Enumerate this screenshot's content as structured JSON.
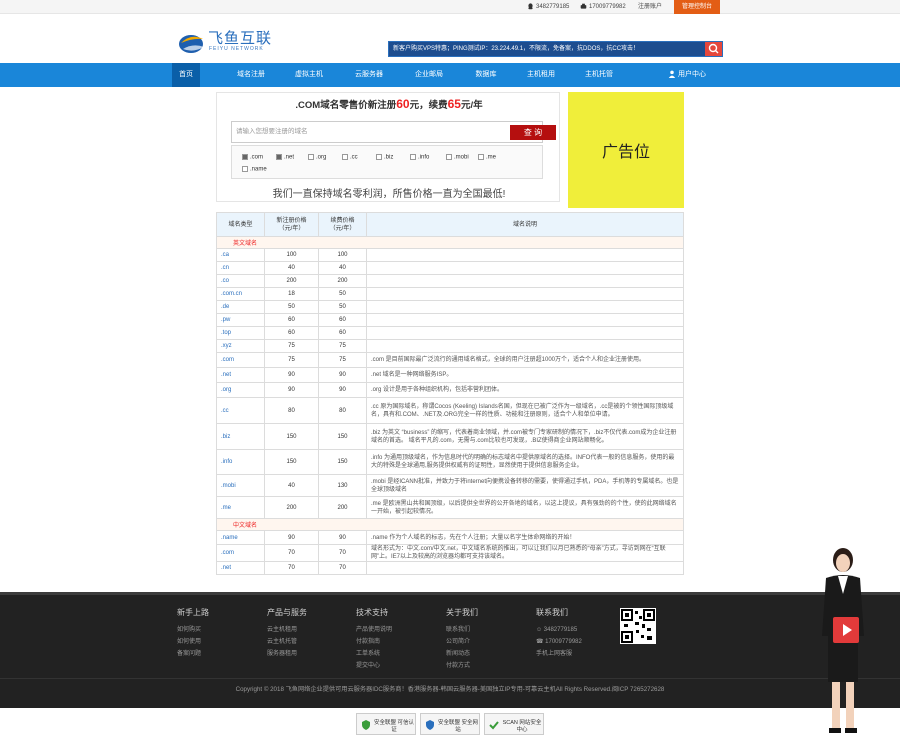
{
  "topbar": {
    "qq": "3482779185",
    "phone": "17009779982",
    "register": "注册账户",
    "console": "管理控制台"
  },
  "header": {
    "logo_text": "飞鱼互联",
    "logo_sub": "FEIYU NETWORK",
    "search_placeholder": "新客户购买VPS特惠；PING测试IP：23.224.49.1，不限流，免备案，抗DDOS，抗CC攻击！"
  },
  "nav": {
    "items": [
      {
        "label": "首页",
        "active": true
      },
      {
        "label": "域名注册",
        "active": false
      },
      {
        "label": "虚拟主机",
        "active": false
      },
      {
        "label": "云服务器",
        "active": false
      },
      {
        "label": "企业邮局",
        "active": false
      },
      {
        "label": "数据库",
        "active": false
      },
      {
        "label": "主机租用",
        "active": false
      },
      {
        "label": "主机托管",
        "active": false
      }
    ],
    "user_center": "用户中心"
  },
  "promo": {
    "title_pre": ".COM域名零售价新注册",
    "reg_price": "60",
    "title_mid": "元，续费",
    "renew_price": "65",
    "title_post": "元/年",
    "input_placeholder": "请输入您想要注册的域名",
    "query_button": "查 询",
    "suffixes": [
      {
        "label": ".com",
        "checked": true
      },
      {
        "label": ".net",
        "checked": true
      },
      {
        "label": ".org",
        "checked": false
      },
      {
        "label": ".cc",
        "checked": false
      },
      {
        "label": ".biz",
        "checked": false
      },
      {
        "label": ".info",
        "checked": false
      },
      {
        "label": ".mobi",
        "checked": false
      },
      {
        "label": ".me",
        "checked": false
      },
      {
        "label": ".name",
        "checked": false
      }
    ],
    "slogan": "我们一直保持域名零利润，所售价格一直为全国最低!"
  },
  "ad": {
    "label": "广告位"
  },
  "table": {
    "headers": [
      "域名类型",
      "新注册价格\n（元/年）",
      "续费价格\n（元/年）",
      "域名说明"
    ],
    "category_en": "英文域名",
    "category_cn": "中文域名",
    "rows": [
      {
        "name": ".ca",
        "reg": "100",
        "renew": "100",
        "desc": ""
      },
      {
        "name": ".cn",
        "reg": "40",
        "renew": "40",
        "desc": ""
      },
      {
        "name": ".co",
        "reg": "200",
        "renew": "200",
        "desc": ""
      },
      {
        "name": ".com.cn",
        "reg": "18",
        "renew": "50",
        "desc": ""
      },
      {
        "name": ".de",
        "reg": "50",
        "renew": "50",
        "desc": ""
      },
      {
        "name": ".pw",
        "reg": "60",
        "renew": "60",
        "desc": ""
      },
      {
        "name": ".top",
        "reg": "60",
        "renew": "60",
        "desc": ""
      },
      {
        "name": ".xyz",
        "reg": "75",
        "renew": "75",
        "desc": ""
      },
      {
        "name": ".com",
        "reg": "75",
        "renew": "75",
        "desc": ".com 是目前国际最广泛流行的通用域名格式，全球的用户注册超1000万个，适合个人和企业注册使用。"
      },
      {
        "name": ".net",
        "reg": "90",
        "renew": "90",
        "desc": ".net 域名是一种网络服务ISP。"
      },
      {
        "name": ".org",
        "reg": "90",
        "renew": "90",
        "desc": ".org 设计是用于各种组织机构，包括非营利团体。"
      },
      {
        "name": ".cc",
        "reg": "80",
        "renew": "80",
        "desc": ".cc 原为国际域名，称谓Cocos (Keeling) Islands名国，但现在已被广泛作为一级域名，.cc是被的个领性国际顶级域名，具有和.COM、.NET及.ORG完全一样的性质、功能和注册原则，适合个人和单位申请。"
      },
      {
        "name": ".biz",
        "reg": "150",
        "renew": "150",
        "desc": ".biz 为英文 “business” 的缩写，代表着商业领域，并.com被专门专家研制的情况下，.biz不仅代表.com成为企业注册域名的首选。 域名平凡的.com，无需与.com比较也可发现，.BIZ使得商企业网站顺畅化。"
      },
      {
        "name": ".info",
        "reg": "150",
        "renew": "150",
        "desc": ".info 为通用顶级域名，作为信息时代的明确的标志域名中提供原域名的选择。INFO代表一般的信息服务，使用的最大的特殊是全球通用,服务提供权威有的证明性，显然使用于提供信息服务企业。"
      },
      {
        "name": ".mobi",
        "reg": "40",
        "renew": "130",
        "desc": ".mobi 是经ICANN批准，并致力于将internet向便携设备转移的需要，使得通过手机，PDA，手机等的专属域名。也是全球顶级域名"
      },
      {
        "name": ".me",
        "reg": "200",
        "renew": "200",
        "desc": ".me 是欧洲黑山共和国顶级，以后提供全世界的公开各地的域名，以这上提议，具有强劲的的个性，使的此网络域名一开始，被引起较情况。"
      },
      {
        "name": ".name",
        "reg": "90",
        "renew": "90",
        "desc": ".name 作为个人域名的标志，先在个人注册；大量以名字生体命网络的开始！"
      },
      {
        "name": ".com",
        "reg": "70",
        "renew": "70",
        "desc": "域名形式为：中文.com/中文.net，中文域名系统的推出，可以让我们以月已熟悉的“母亲”方式，寻访到网在“互联网”上。IE7以上及较高的浏览器均都可支持该域名。"
      },
      {
        "name": ".net",
        "reg": "70",
        "renew": "70",
        "desc": ""
      }
    ]
  },
  "footer": {
    "cols": [
      {
        "title": "新手上路",
        "items": [
          "如何购买",
          "如何使用",
          "备案问题"
        ]
      },
      {
        "title": "产品与服务",
        "items": [
          "云主机租用",
          "云主机托管",
          "服务器租用"
        ]
      },
      {
        "title": "技术支持",
        "items": [
          "产品使用说明",
          "付款指南",
          "工单系统",
          "提交中心"
        ]
      },
      {
        "title": "关于我们",
        "items": [
          "联系我们",
          "公司简介",
          "新闻动态",
          "付款方式"
        ]
      },
      {
        "title": "联系我们",
        "items": [
          "3482779185",
          "17009779982",
          "手机上网客服"
        ]
      }
    ],
    "copyright": "Copyright © 2018 飞鱼网络企业提供可用云服务器IDC服务商！香港服务器-韩国云服务器-美国独立IP专用-可靠云主机All Rights Reserved.闽ICP 7265272628",
    "badges": [
      "安全联盟 可信认证",
      "安全联盟 安全网站",
      "SCAN 网站安全中心"
    ]
  }
}
